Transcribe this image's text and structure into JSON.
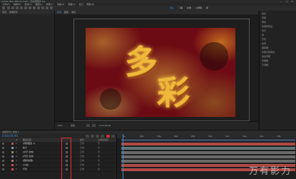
{
  "window": {
    "title": "Adobe After Effects 2020 - 无标题项目.aep",
    "controls": "— ▢ ✕"
  },
  "menu": [
    "文件(F)",
    "编辑(E)",
    "合成(C)",
    "图层(L)",
    "效果(T)",
    "动画(A)",
    "视图(V)",
    "窗口",
    "帮助(H)"
  ],
  "workspace": [
    "默认",
    "了解",
    "标准",
    "小屏幕",
    "库"
  ],
  "project_panel": {
    "tabs": [
      "项目",
      "效果控件"
    ]
  },
  "viewer": {
    "tabs": [
      "合成",
      "图层",
      "素材"
    ],
    "artwork_text": [
      "多",
      "彩"
    ],
    "controls": [
      "50%",
      "完整",
      "0:00:00:00"
    ]
  },
  "right_panel": {
    "items": [
      "信息",
      "音频",
      "预览",
      "效果和预设",
      "对齐",
      "库",
      "字符",
      "段落",
      "跟踪器",
      "内容识别填充",
      "动态草图",
      "摇摆器",
      "平滑器"
    ]
  },
  "timeline": {
    "tab": "渲染队列 | 合成 1",
    "timecode": "0:00:00:00",
    "columns": {
      "num": "#",
      "name": "图层名称",
      "mode": "模式",
      "parent": "父级和链接"
    },
    "layers": [
      {
        "num": "1",
        "name": "[调整图层 1]",
        "color": "#c9524e",
        "mode": "正常",
        "parent": "无"
      },
      {
        "num": "2",
        "name": "粒子",
        "color": "#7c9a9a",
        "mode": "正常",
        "parent": "无"
      },
      {
        "num": "3",
        "name": "[文字 合成]",
        "color": "#8a8a6a",
        "mode": "正常",
        "parent": "无"
      },
      {
        "num": "4",
        "name": "[背景 合成]",
        "color": "#6a7a9a",
        "mode": "正常",
        "parent": "无"
      },
      {
        "num": "5",
        "name": "[颗粒纹理]",
        "color": "#9a7a6a",
        "mode": "正常",
        "parent": "无"
      },
      {
        "num": "6",
        "name": "[火焰]",
        "color": "#c9524e",
        "mode": "正常",
        "parent": "无"
      },
      {
        "num": "7",
        "name": "背景",
        "color": "#c9524e",
        "mode": "正常",
        "parent": "无"
      }
    ],
    "ruler": [
      "0s",
      "02s",
      "04s",
      "06s",
      "08s",
      "10s",
      "12s",
      "14s",
      "16s",
      "18s"
    ]
  },
  "watermark": "万有影力"
}
